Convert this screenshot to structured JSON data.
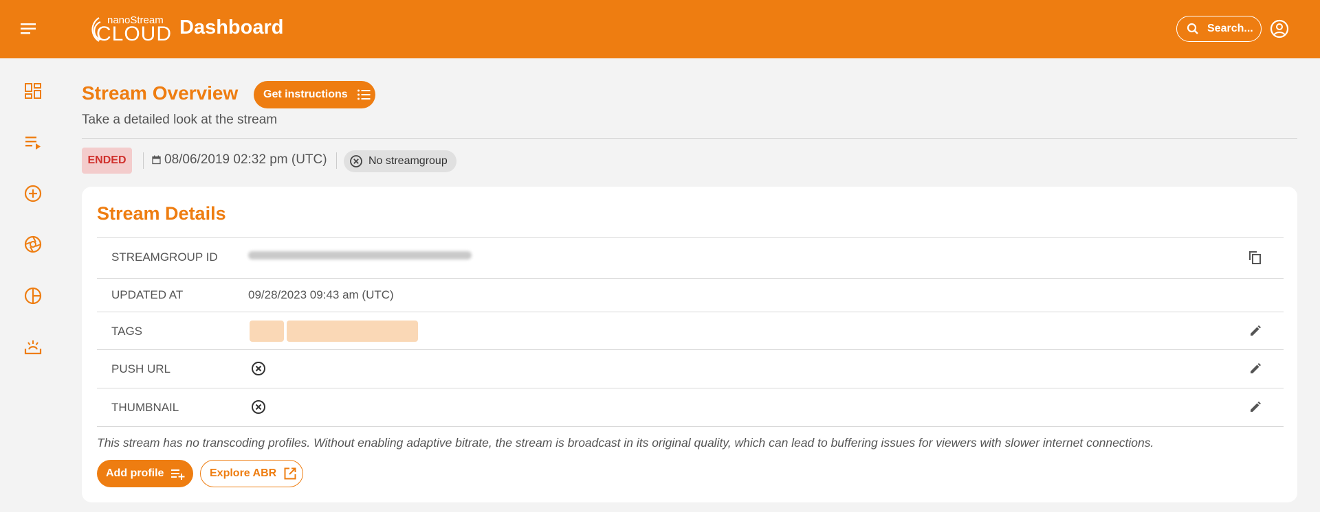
{
  "header": {
    "logo_small": "nanoStream",
    "logo_big": "CLOUD",
    "title": "Dashboard",
    "search_label": "Search..."
  },
  "sidebar": {
    "items": [
      "dashboard-icon",
      "playlist-icon",
      "add-circle-icon",
      "camera-aperture-icon",
      "pie-chart-icon",
      "ingest-icon"
    ]
  },
  "page": {
    "title": "Stream Overview",
    "instructions_button": "Get instructions",
    "subtitle": "Take a detailed look at the stream"
  },
  "status": {
    "badge": "ENDED",
    "date": "08/06/2019 02:32 pm (UTC)",
    "streamgroup": "No streamgroup"
  },
  "details": {
    "title": "Stream Details",
    "rows": [
      {
        "label": "STREAMGROUP ID",
        "value": ""
      },
      {
        "label": "UPDATED AT",
        "value": "09/28/2023 09:43 am (UTC)"
      },
      {
        "label": "TAGS",
        "value": ""
      },
      {
        "label": "PUSH URL",
        "value": ""
      },
      {
        "label": "THUMBNAIL",
        "value": ""
      }
    ],
    "note": "This stream has no transcoding profiles. Without enabling adaptive bitrate, the stream is broadcast in its original quality, which can lead to buffering issues for viewers with slower internet connections.",
    "add_profile": "Add profile",
    "explore_abr": "Explore ABR"
  },
  "colors": {
    "accent": "#ee7d11",
    "status_ended_bg": "#f3cccc",
    "status_ended_text": "#d0312d",
    "tag_bg": "#fad8b6"
  }
}
